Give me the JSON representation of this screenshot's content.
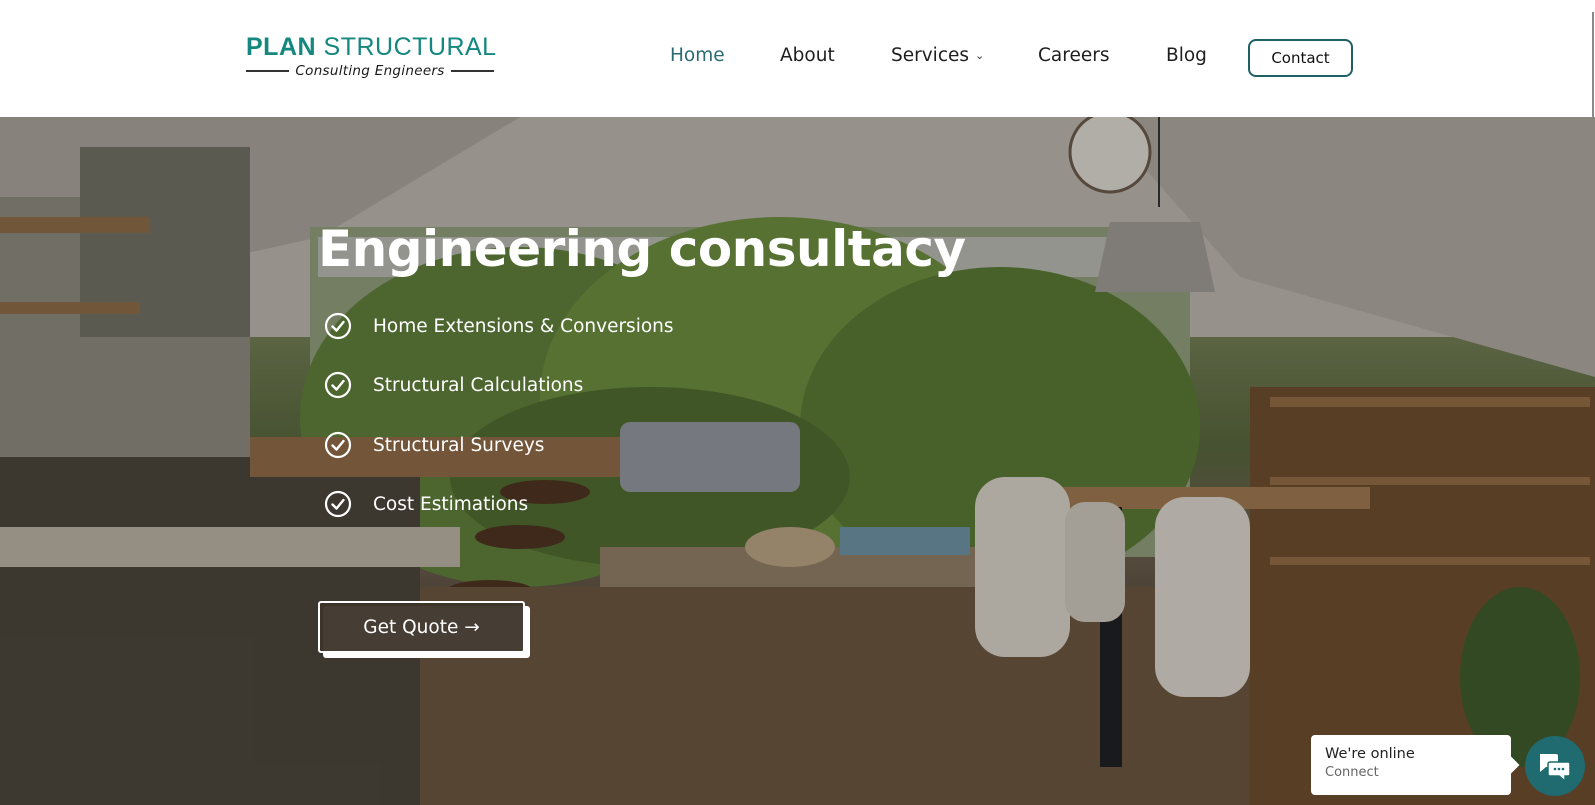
{
  "brand": {
    "name_bold": "PLAN",
    "name_light": "STRUCTURAL",
    "tagline": "Consulting Engineers",
    "color": "#14877f"
  },
  "nav": {
    "items": [
      {
        "label": "Home",
        "active": true
      },
      {
        "label": "About",
        "active": false
      },
      {
        "label": "Services",
        "active": false,
        "has_dropdown": true
      },
      {
        "label": "Careers",
        "active": false
      },
      {
        "label": "Blog",
        "active": false
      }
    ],
    "dropdown_icon": "chevron-down-icon",
    "contact_label": "Contact",
    "accent_color": "#1f5f66"
  },
  "hero": {
    "title": "Engineering consultacy",
    "features": [
      {
        "icon": "check-circle-icon",
        "label": "Home Extensions & Conversions"
      },
      {
        "icon": "check-circle-icon",
        "label": "Structural Calculations"
      },
      {
        "icon": "check-circle-icon",
        "label": "Structural Surveys"
      },
      {
        "icon": "check-circle-icon",
        "label": "Cost Estimations"
      }
    ],
    "cta_label": "Get Quote →",
    "background": "kitchen-dining-interior-photo"
  },
  "chat": {
    "title": "We're online",
    "subtitle": "Connect",
    "icon": "chat-bubbles-icon",
    "color": "#1f6b6f"
  }
}
